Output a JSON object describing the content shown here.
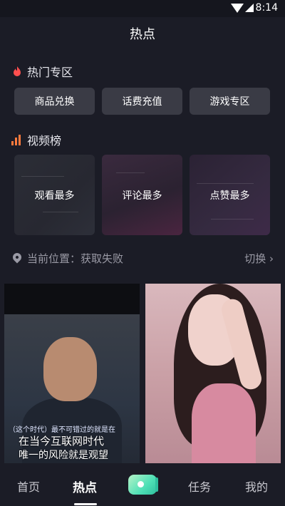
{
  "status_bar": {
    "time": "8:14"
  },
  "header": {
    "title": "热点"
  },
  "hot_zone": {
    "title": "热门专区",
    "chips": [
      "商品兑换",
      "话费充值",
      "游戏专区"
    ]
  },
  "video_rank": {
    "title": "视频榜",
    "cards": [
      "观看最多",
      "评论最多",
      "点赞最多"
    ]
  },
  "location": {
    "label": "当前位置：获取失败",
    "switch": "切换 ›"
  },
  "videos": [
    {
      "caption_small": "（这个时代）最不可错过的就是在",
      "caption_line1": "在当今互联网时代",
      "caption_line2": "唯一的风险就是观望"
    },
    {}
  ],
  "bottom_nav": {
    "home": "首页",
    "hot": "热点",
    "task": "任务",
    "me": "我的"
  },
  "colors": {
    "background": "#1b1c26",
    "chip": "#3a3b45",
    "accent": "#ff7a3d"
  }
}
